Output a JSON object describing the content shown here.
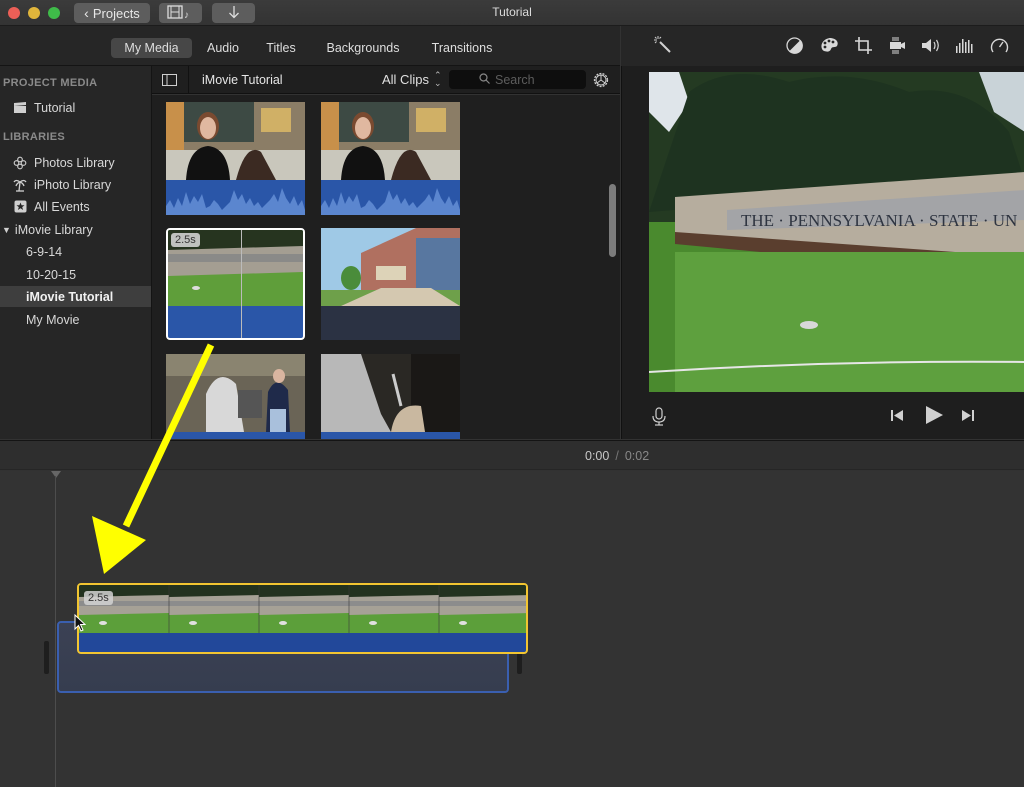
{
  "window": {
    "title": "Tutorial",
    "traffic_lights": {
      "close": "#ec5f57",
      "minimize": "#e0b53b",
      "zoom": "#3fbb49"
    },
    "projects_button": "Projects",
    "media_toggle_icon": "film-music-icon",
    "import_icon": "download-arrow-icon"
  },
  "tabs": [
    {
      "label": "My Media",
      "active": true
    },
    {
      "label": "Audio",
      "active": false
    },
    {
      "label": "Titles",
      "active": false
    },
    {
      "label": "Backgrounds",
      "active": false
    },
    {
      "label": "Transitions",
      "active": false
    }
  ],
  "sidebar": {
    "project_media_header": "PROJECT MEDIA",
    "project_item": {
      "label": "Tutorial",
      "icon": "clapperboard-icon"
    },
    "libraries_header": "LIBRARIES",
    "libraries": [
      {
        "label": "Photos Library",
        "icon": "photos-flower-icon"
      },
      {
        "label": "iPhoto Library",
        "icon": "palm-tree-icon"
      },
      {
        "label": "All Events",
        "icon": "star-icon"
      }
    ],
    "imovie_library": {
      "label": "iMovie Library",
      "expanded": true,
      "events": [
        {
          "label": "6-9-14",
          "selected": false
        },
        {
          "label": "10-20-15",
          "selected": false
        },
        {
          "label": "iMovie Tutorial",
          "selected": true
        },
        {
          "label": "My Movie",
          "selected": false
        }
      ]
    }
  },
  "browser": {
    "title": "iMovie Tutorial",
    "filter": "All Clips",
    "search_placeholder": "Search",
    "clips": [
      {
        "subject": "woman-talking",
        "audio": "waveform"
      },
      {
        "subject": "woman-talking",
        "audio": "waveform"
      },
      {
        "subject": "penn-state-sign",
        "audio": "none",
        "duration": "2.5s",
        "selected": true
      },
      {
        "subject": "office-building",
        "audio": "none"
      },
      {
        "subject": "foundry-workers",
        "audio": "none"
      },
      {
        "subject": "foundry-pour",
        "audio": "none"
      }
    ]
  },
  "viewer": {
    "toolbar_icons": [
      "magic-wand-icon",
      "color-balance-icon",
      "color-correction-icon",
      "crop-icon",
      "stabilization-icon",
      "volume-icon",
      "equalizer-icon",
      "speed-icon"
    ],
    "sign_text": "THE · PENNSYLVANIA · STATE · UN",
    "controls": [
      "microphone-icon",
      "skip-back-icon",
      "play-icon",
      "skip-forward-icon"
    ]
  },
  "timeline": {
    "current_time": "0:00",
    "separator": "/",
    "total_time": "0:02",
    "dragged_clip_duration": "2.5s"
  },
  "annotation": {
    "arrow_color": "#ffff00"
  }
}
